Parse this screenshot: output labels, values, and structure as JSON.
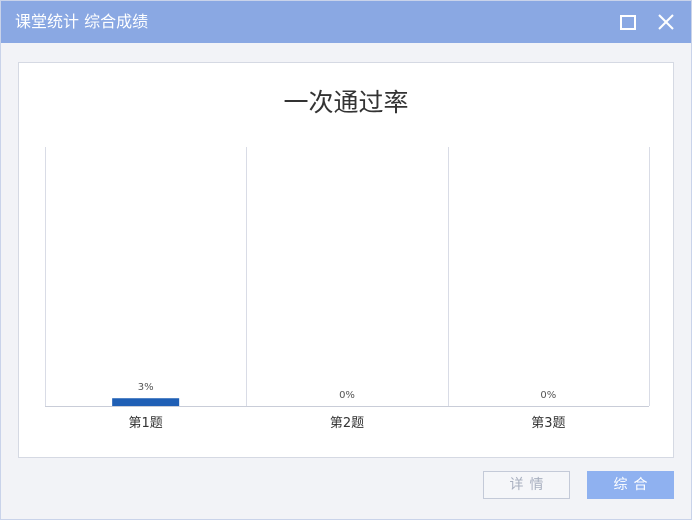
{
  "window": {
    "title": "课堂统计 综合成绩",
    "maximize_icon": "maximize-icon",
    "close_icon": "close-icon"
  },
  "chart_data": {
    "type": "bar",
    "title": "一次通过率",
    "categories": [
      "第1题",
      "第2题",
      "第3题"
    ],
    "values": [
      3,
      0,
      0
    ],
    "data_labels": [
      "3%",
      "0%",
      "0%"
    ],
    "ylim": [
      0,
      100
    ],
    "bar_color": "#1f5fb5",
    "grid": true
  },
  "buttons": {
    "detail_label": "详情",
    "summary_label": "综合"
  },
  "colors": {
    "titlebar": "#8aa8e3",
    "accent_button": "#8fb1f0"
  }
}
